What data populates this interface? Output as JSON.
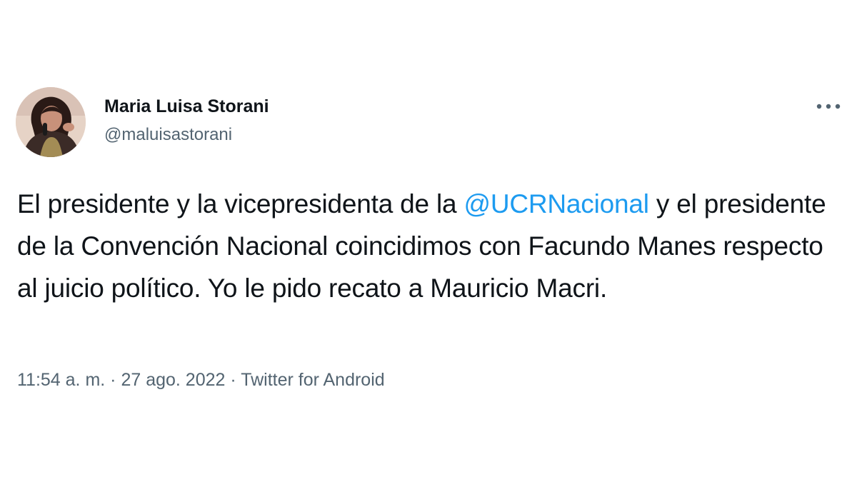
{
  "user": {
    "display_name": "Maria Luisa Storani",
    "handle": "@maluisastorani"
  },
  "menu": {
    "icon": "more-horizontal-icon"
  },
  "tweet": {
    "text_before_mention": "El presidente y la vicepresidenta de la ",
    "mention": "@UCRNacional",
    "text_after_mention": " y el presidente de la Convención Nacional coincidimos con Facundo Manes respecto al juicio político. Yo le pido recato a Mauricio Macri."
  },
  "meta": {
    "time": "11:54 a. m.",
    "separator_1": " · ",
    "date": "27 ago. 2022",
    "separator_2": " · ",
    "source": "Twitter for Android"
  },
  "colors": {
    "text": "#0f1419",
    "secondary": "#536471",
    "accent": "#1d9bf0",
    "background": "#ffffff"
  }
}
